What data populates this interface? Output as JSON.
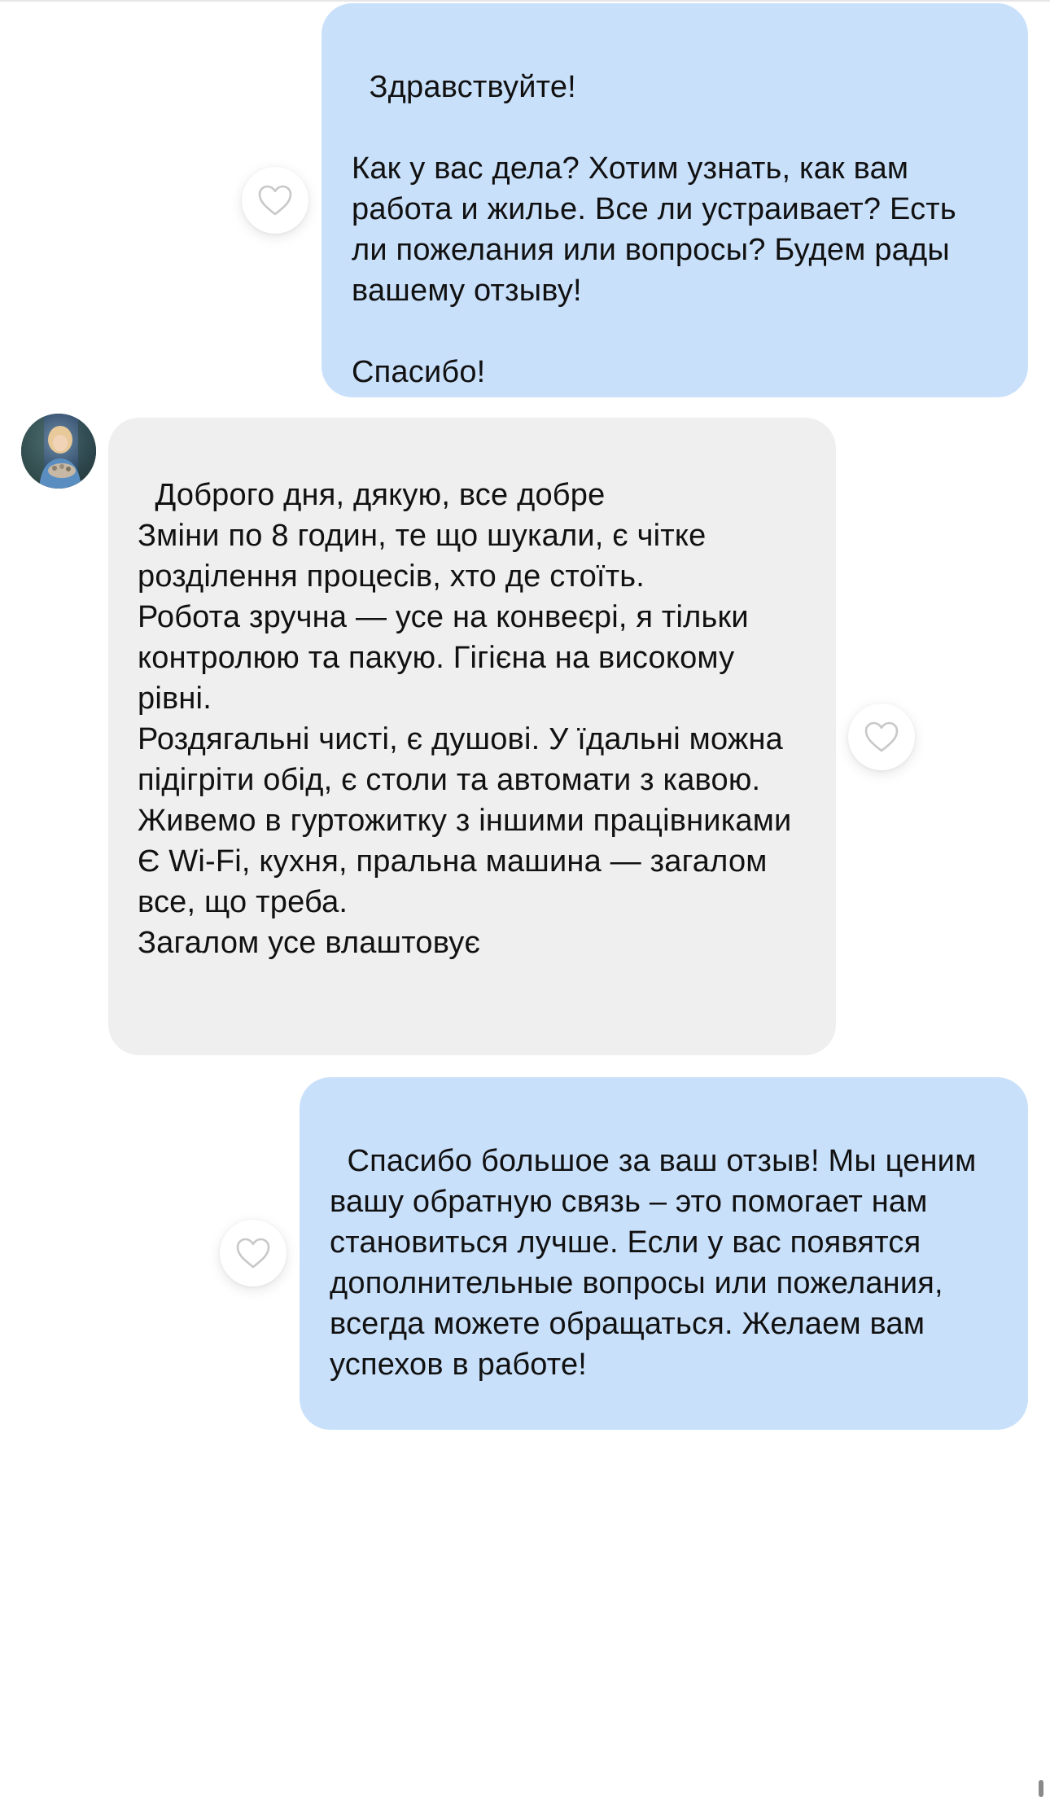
{
  "conversation": {
    "messages": [
      {
        "direction": "outgoing",
        "text": "Здравствуйте!\n\nКак у вас дела? Хотим узнать, как вам работа и жилье. Все ли устраивает? Есть ли пожелания или вопросы? Будем рады вашему отзыву!\n\nСпасибо!"
      },
      {
        "direction": "incoming",
        "text": "Доброго дня, дякую, все добре\nЗміни по 8 годин, те що шукали, є чітке розділення процесів, хто де стоїть.\nРобота зручна — усе на конвеєрі, я тільки контролюю та пакую. Гігієна на високому рівні.\nРоздягальні чисті, є душові. У їдальні можна підігріти обід, є столи та автомати з кавою.\nЖивемо в гуртожитку з іншими працівниками\nЄ Wi-Fi, кухня, пральна машина — загалом все, що треба.\nЗагалом усе влаштовує"
      },
      {
        "direction": "outgoing",
        "text": "Спасибо большое за ваш отзыв! Мы ценим вашу обратную связь – это помогает нам становиться лучше. Если у вас появятся дополнительные вопросы или пожелания, всегда можете обращаться. Желаем вам успехов в работе!"
      }
    ]
  },
  "icons": {
    "like": "heart-outline-icon",
    "sender_avatar": "avatar"
  },
  "colors": {
    "outgoing_bubble": "#c9e0fb",
    "incoming_bubble": "#efefef",
    "heart_stroke": "#c8c8c8"
  }
}
